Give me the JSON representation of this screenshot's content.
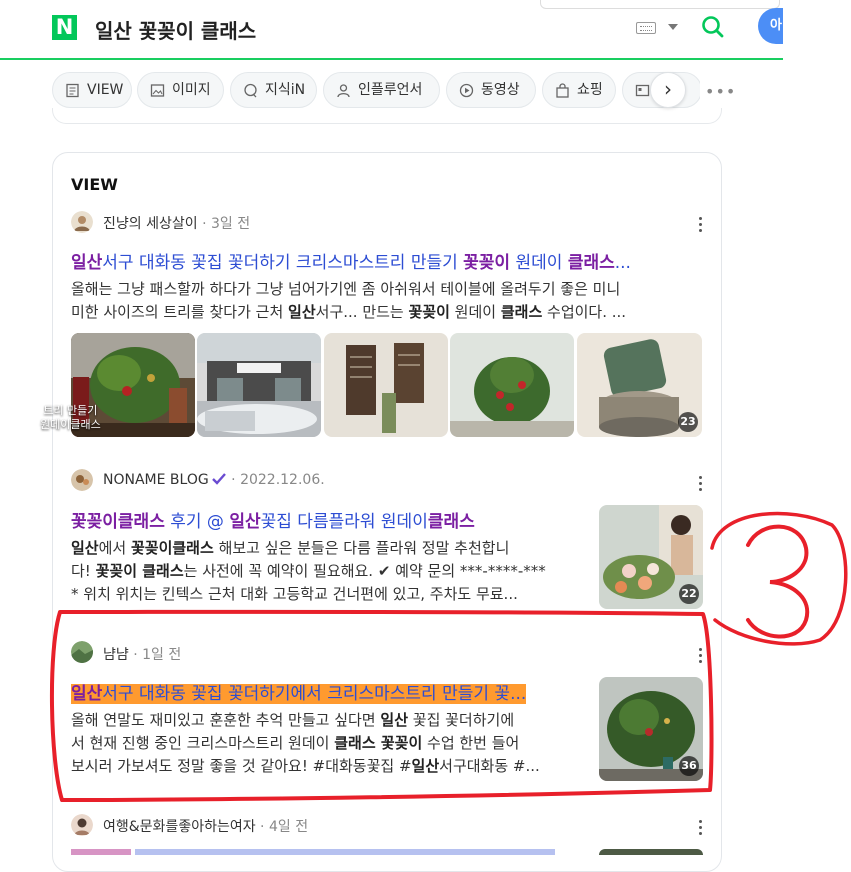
{
  "header": {
    "logo_letter": "N",
    "query": "일산 꽃꽂이 클래스",
    "profile_text": "아"
  },
  "tabs": [
    {
      "label": "VIEW",
      "icon": "document-icon"
    },
    {
      "label": "이미지",
      "icon": "image-icon"
    },
    {
      "label": "지식iN",
      "icon": "qna-icon"
    },
    {
      "label": "인플루언서",
      "icon": "person-icon"
    },
    {
      "label": "동영상",
      "icon": "play-icon"
    },
    {
      "label": "쇼핑",
      "icon": "shopping-bag-icon"
    },
    {
      "label": "",
      "icon": "news-icon"
    }
  ],
  "view_section": {
    "title": "VIEW",
    "posts": [
      {
        "author": "진냥의 세상살이",
        "date": "3일 전",
        "title_parts": [
          {
            "t": "일산",
            "hl": true
          },
          {
            "t": "서구 대화동 꽃집 꽃더하기 크리스마스트리 만들기 ",
            "hl": false
          },
          {
            "t": "꽃꽂이",
            "hl": true
          },
          {
            "t": " 원데이 ",
            "hl": false
          },
          {
            "t": "클래스",
            "hl": true
          },
          {
            "t": "...",
            "hl": false
          }
        ],
        "desc_line1": "올해는 그냥 패스할까 하다가 그냥 넘어가기엔 좀 아쉬워서 테이블에 올려두기 좋은 미니",
        "desc_line2_parts": [
          {
            "t": "미한 사이즈의 트리를 찾다가 근처 ",
            "b": false
          },
          {
            "t": "일산",
            "b": true
          },
          {
            "t": "서구... 만드는 ",
            "b": false
          },
          {
            "t": "꽃꽂이",
            "b": true
          },
          {
            "t": " 원데이 ",
            "b": false
          },
          {
            "t": "클래스",
            "b": true
          },
          {
            "t": " 수업이다. ...",
            "b": false
          }
        ],
        "thumb_caption_line1": "트리 만들기",
        "thumb_caption_line2": "원데이클래스",
        "thumb_count": "23"
      },
      {
        "author": "NONAME BLOG",
        "date": "2022.12.06.",
        "title_parts": [
          {
            "t": "꽃꽂이클래스",
            "hl": true
          },
          {
            "t": " 후기 @ ",
            "hl": false
          },
          {
            "t": "일산",
            "hl": true
          },
          {
            "t": "꽃집 다름플라워 원데이",
            "hl": false
          },
          {
            "t": "클래스",
            "hl": true
          }
        ],
        "desc_line1_parts": [
          {
            "t": "일산",
            "b": true
          },
          {
            "t": "에서 ",
            "b": false
          },
          {
            "t": "꽃꽂이클래스",
            "b": true
          },
          {
            "t": " 해보고 싶은 분들은 다름 플라워 정말 추천합니",
            "b": false
          }
        ],
        "desc_line2_parts": [
          {
            "t": "다! ",
            "b": false
          },
          {
            "t": "꽃꽂이 클래스",
            "b": true
          },
          {
            "t": "는 사전에 꼭 예약이 필요해요. ✔ 예약 문의 ***-****-***",
            "b": false
          }
        ],
        "desc_line3": "* 위치 위치는 킨텍스 근처 대화 고등학교 건너편에 있고, 주차도 무료...",
        "thumb_count": "22"
      },
      {
        "author": "냠냠",
        "date": "1일 전",
        "title_parts": [
          {
            "t": "일산",
            "hl": true
          },
          {
            "t": "서구 대화동 꽃집 꽃더하기에서 크리스마스트리 만들기 꽃...",
            "hl": false
          }
        ],
        "desc_line1_parts": [
          {
            "t": "올해 연말도 재미있고 훈훈한 추억 만들고 싶다면 ",
            "b": false
          },
          {
            "t": "일산",
            "b": true
          },
          {
            "t": " 꽃집 꽃더하기에",
            "b": false
          }
        ],
        "desc_line2_parts": [
          {
            "t": "서 현재 진행 중인 크리스마스트리 원데이 ",
            "b": false
          },
          {
            "t": "클래스 꽃꽂이",
            "b": true
          },
          {
            "t": " 수업 한번 들어",
            "b": false
          }
        ],
        "desc_line3_parts": [
          {
            "t": "보시러 가보셔도 정말 좋을 것 같아요! #대화동꽃집 #",
            "b": false
          },
          {
            "t": "일산",
            "b": true
          },
          {
            "t": "서구대화동 #...",
            "b": false
          }
        ],
        "thumb_count": "36"
      },
      {
        "author": "여행&문화를좋아하는여자",
        "date": "4일 전"
      }
    ]
  },
  "annotation": {
    "label": "3",
    "color": "#e8202a"
  },
  "colors": {
    "brand": "#03c75a",
    "title_link": "#2d4dd3",
    "title_highlight": "#7b1fa2",
    "orange_highlight": "#ff9a2f"
  }
}
